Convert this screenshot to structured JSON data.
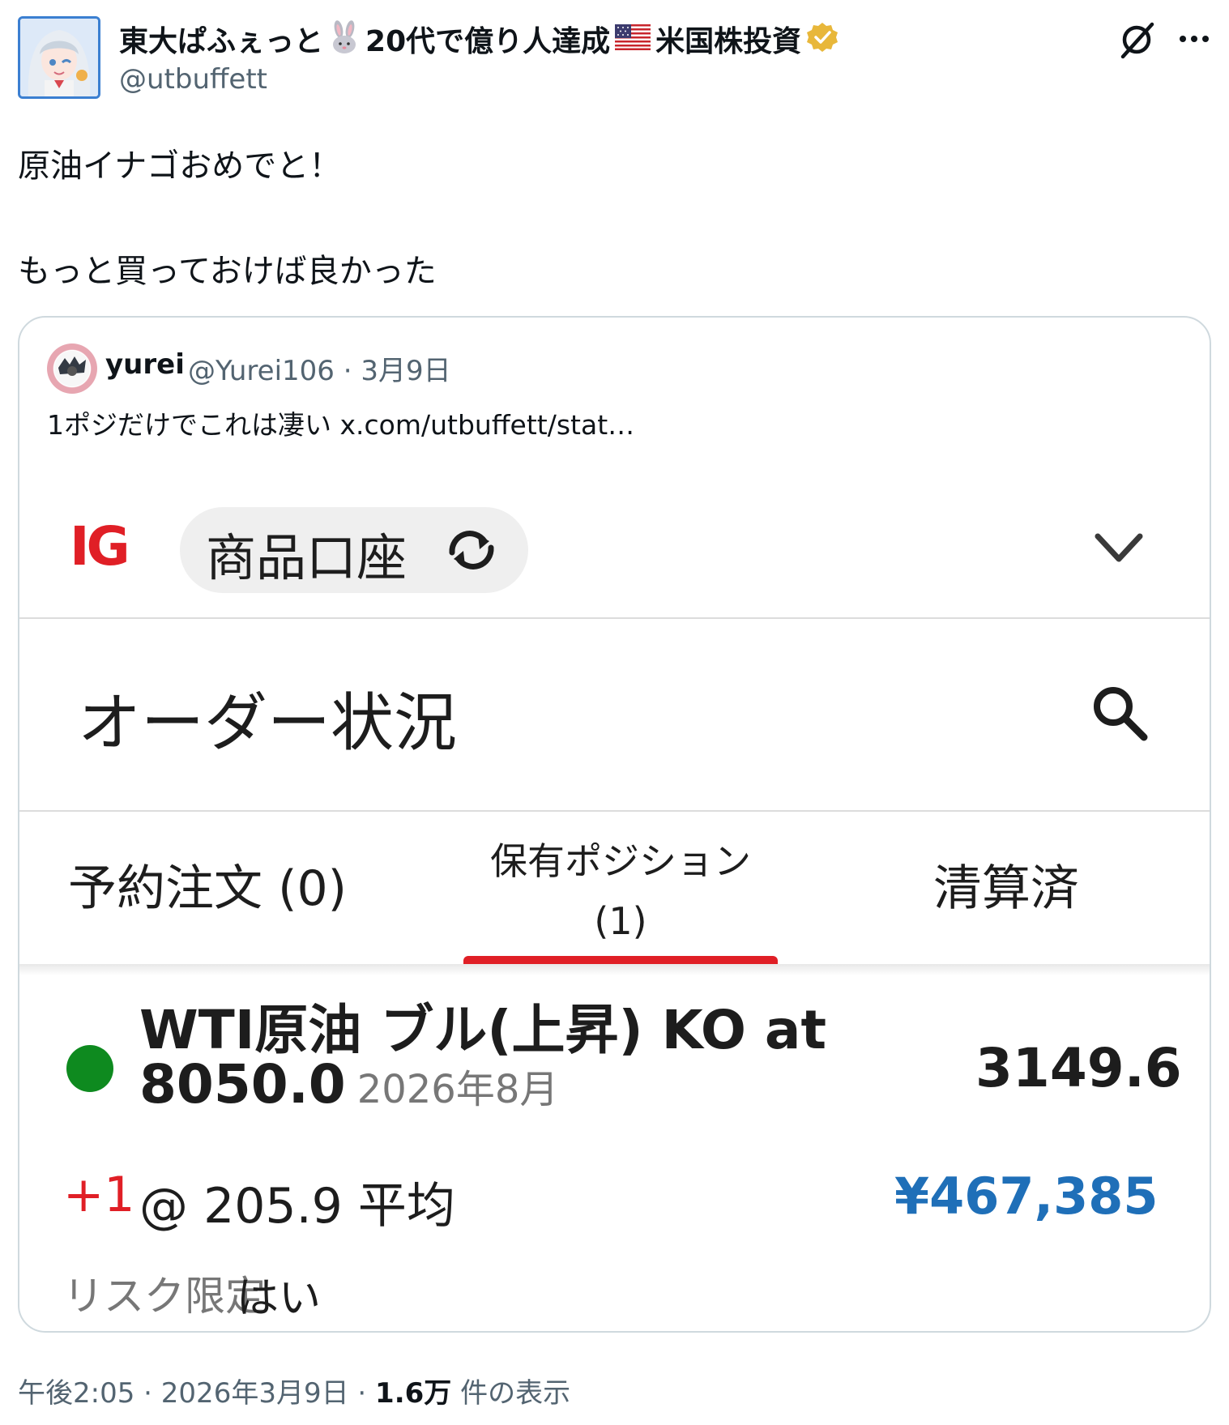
{
  "author": {
    "display_name": "東大ぱふぇっと",
    "display_name_part2": "20代で億り人達成",
    "display_name_part3": "米国株投資",
    "handle": "@utbuffett",
    "icons": [
      "rabbit-emoji",
      "us-flag-emoji",
      "verified-badge-icon"
    ]
  },
  "header_actions": {
    "grok_icon": "grok-icon",
    "more_icon": "more-options-icon"
  },
  "post": {
    "line1": "原油イナゴおめでと！",
    "line2": "もっと買っておけば良かった"
  },
  "quote": {
    "name": "yurei",
    "meta": "@Yurei106 · 3月9日",
    "text": "1ポジだけでこれは凄い  x.com/utbuffett/stat…"
  },
  "app": {
    "logo": "IG",
    "account": "商品口座",
    "page_title": "オーダー状況",
    "tabs": [
      {
        "label": "予約注文 (0)",
        "active": false
      },
      {
        "label_line1": "保有ポジション",
        "label_line2": "(1)",
        "active": true
      },
      {
        "label": "清算済",
        "active": false
      }
    ],
    "position": {
      "name_line1": "WTI原油 ブル(上昇) KO at",
      "name_line2": "8050.0",
      "expiry": "2026年8月",
      "price": "3149.6",
      "size": "+1",
      "avg": "@ 205.9 平均",
      "pnl": "¥467,385",
      "risk_label": "リスク限定",
      "risk_value": "はい"
    },
    "colors": {
      "brand": "#e01f26",
      "status_dot": "#0e8a1f",
      "pnl": "#1f6fb8"
    }
  },
  "footer": {
    "time": "午後2:05",
    "date": "2026年3月9日",
    "views": "1.6万",
    "views_suffix": "件の表示"
  }
}
